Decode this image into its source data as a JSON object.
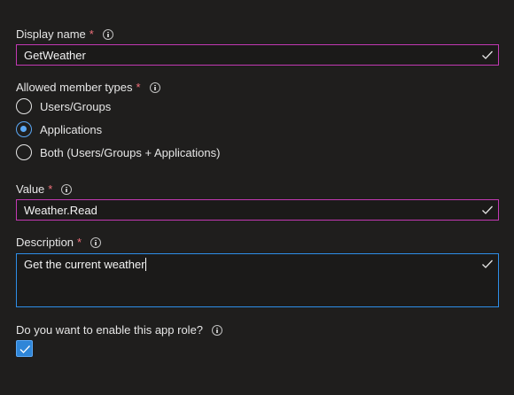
{
  "display_name": {
    "label": "Display name",
    "required_marker": "*",
    "value": "GetWeather"
  },
  "member_types": {
    "label": "Allowed member types",
    "required_marker": "*",
    "options": [
      {
        "label": "Users/Groups",
        "selected": false
      },
      {
        "label": "Applications",
        "selected": true
      },
      {
        "label": "Both (Users/Groups + Applications)",
        "selected": false
      }
    ]
  },
  "value_field": {
    "label": "Value",
    "required_marker": "*",
    "value": "Weather.Read"
  },
  "description": {
    "label": "Description",
    "required_marker": "*",
    "value": "Get the current weather"
  },
  "enable_role": {
    "label": "Do you want to enable this app role?",
    "checked": true
  },
  "icons": {
    "info": "info-icon",
    "valid": "checkmark-icon",
    "checkbox_check": "checkmark-icon"
  },
  "colors": {
    "background": "#1f1e1d",
    "field_border": "#c239b3",
    "focus_border": "#2e8ee8",
    "accent": "#5ba8f5",
    "required": "#f1707b"
  }
}
